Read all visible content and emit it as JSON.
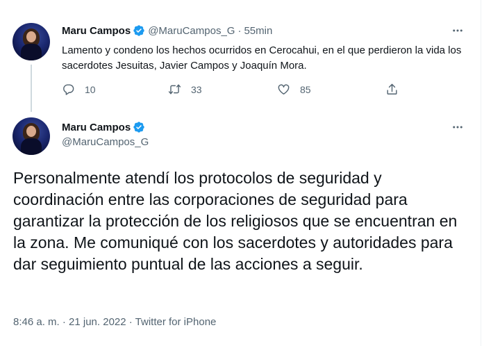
{
  "parent_tweet": {
    "author_name": "Maru Campos",
    "handle": "@MaruCampos_G",
    "separator": "·",
    "time_ago": "55min",
    "text": "Lamento y condeno los hechos ocurridos en Cerocahui, en el que perdieron la vida los sacerdotes Jesuitas, Javier Campos y Joaquín Mora.",
    "replies": "10",
    "retweets": "33",
    "likes": "85"
  },
  "main_tweet": {
    "author_name": "Maru Campos",
    "handle": "@MaruCampos_G",
    "text": "Personalmente atendí los protocolos de seguridad y coordinación entre las corporaciones de seguridad para garantizar la protección de los religiosos que se encuentran en la zona. Me comuniqué con los sacerdotes y autoridades para dar seguimiento puntual de las acciones a seguir.",
    "timestamp": "8:46 a. m. · 21 jun. 2022 · Twitter for iPhone"
  },
  "colors": {
    "verified": "#1d9bf0",
    "muted": "#536471",
    "text": "#0f1419"
  },
  "icons": [
    "reply-icon",
    "retweet-icon",
    "like-icon",
    "share-icon",
    "more-icon",
    "verified-badge-icon"
  ]
}
